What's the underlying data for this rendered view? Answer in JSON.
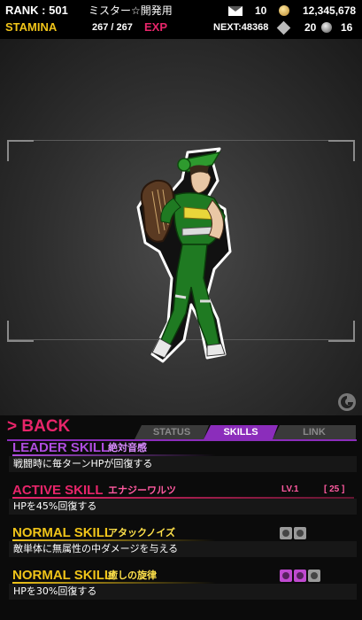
{
  "header": {
    "rank_label": "RANK : 501",
    "player_name": "ミスター☆開発用",
    "mail_icon": "mail-icon",
    "mail_count": "10",
    "coin_icon": "coin-icon",
    "coin_count": "12,345,678",
    "stamina_label": "STAMINA",
    "stamina_value": "267 / 267",
    "exp_label": "EXP",
    "next_exp": "NEXT:48368",
    "ticket_icon": "ticket-icon",
    "ticket_count": "20",
    "gem_icon": "gem-icon",
    "gem_count": "16"
  },
  "viewer": {
    "character": "harp-player-character",
    "watermark_icon": "gamer-logo-icon"
  },
  "panel": {
    "back_label": "> BACK",
    "tabs": [
      {
        "label": "STATUS",
        "active": false
      },
      {
        "label": "SKILLS",
        "active": true
      },
      {
        "label": "LINK",
        "active": false
      }
    ],
    "accent": "#8b2dbb",
    "skills": [
      {
        "type": "LEADER SKILL",
        "name": "絶対音感",
        "description": "戦闘時に毎ターンHPが回復する",
        "color": "#b04de0",
        "name_color": "#d98cff"
      },
      {
        "type": "ACTIVE SKILL",
        "name": "エナジーワルツ",
        "description": "HPを45%回復する",
        "level": "LV.1",
        "cost": "[ 25 ]",
        "color": "#e8256a",
        "name_color": "#ff5aa0"
      },
      {
        "type": "NORMAL SKILL",
        "name": "アタックノイズ",
        "description": "敵単体に無属性の中ダメージを与える",
        "color": "#f0c419",
        "name_color": "#ffe14a",
        "badge_icons": [
          "gray-note-icon",
          "gray-note-icon"
        ]
      },
      {
        "type": "NORMAL SKILL",
        "name": "癒しの旋律",
        "description": "HPを30%回復する",
        "color": "#f0c419",
        "name_color": "#ffe14a",
        "badge_icons": [
          "pink-note-icon",
          "pink-note-icon",
          "gray-note-icon"
        ]
      }
    ]
  }
}
